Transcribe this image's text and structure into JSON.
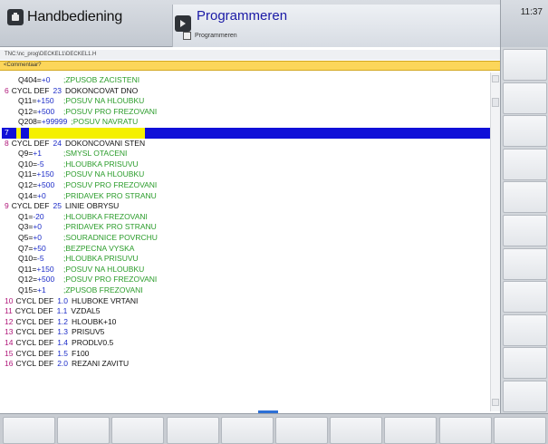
{
  "header": {
    "mode_left": "Handbediening",
    "mode_right": "Programmeren",
    "mode_right_sub": "Programmeren",
    "clock": "11:37"
  },
  "path": "TNC:\\nc_prog\\DECKEL1\\DECKEL1.H",
  "comment_bar": "<Commentaar?",
  "colors": {
    "line_number": "#b0187a",
    "value": "#1c2cc8",
    "comment": "#2a9c2a",
    "selection": "#1010d8",
    "cursor": "#f4f000",
    "comment_bar": "#fcd65a"
  },
  "program": [
    {
      "ln": "",
      "indent": true,
      "q": "Q404=+0",
      "c": ";ZPUSOB ZACISTENI"
    },
    {
      "ln": "6",
      "kw": "CYCL DEF",
      "num": "23",
      "txt": "DOKONCOVAT DNO"
    },
    {
      "ln": "",
      "indent": true,
      "q": "Q11=+150",
      "c": ";POSUV NA HLOUBKU"
    },
    {
      "ln": "",
      "indent": true,
      "q": "Q12=+500",
      "c": ";POSUV PRO FREZOVANI"
    },
    {
      "ln": "",
      "indent": true,
      "q": "Q208=+99999",
      "c": ";POSUV NAVRATU"
    },
    {
      "ln": "7",
      "selected": true
    },
    {
      "ln": "8",
      "kw": "CYCL DEF",
      "num": "24",
      "txt": "DOKONCOVANI STEN"
    },
    {
      "ln": "",
      "indent": true,
      "q": "Q9=+1",
      "c": ";SMYSL OTACENI"
    },
    {
      "ln": "",
      "indent": true,
      "q": "Q10=-5",
      "c": ";HLOUBKA PRISUVU"
    },
    {
      "ln": "",
      "indent": true,
      "q": "Q11=+150",
      "c": ";POSUV NA HLOUBKU"
    },
    {
      "ln": "",
      "indent": true,
      "q": "Q12=+500",
      "c": ";POSUV PRO FREZOVANI"
    },
    {
      "ln": "",
      "indent": true,
      "q": "Q14=+0",
      "c": ";PRIDAVEK PRO STRANU"
    },
    {
      "ln": "9",
      "kw": "CYCL DEF",
      "num": "25",
      "txt": "LINIE OBRYSU"
    },
    {
      "ln": "",
      "indent": true,
      "q": "Q1=-20",
      "c": ";HLOUBKA FREZOVANI"
    },
    {
      "ln": "",
      "indent": true,
      "q": "Q3=+0",
      "c": ";PRIDAVEK PRO STRANU"
    },
    {
      "ln": "",
      "indent": true,
      "q": "Q5=+0",
      "c": ";SOURADNICE POVRCHU"
    },
    {
      "ln": "",
      "indent": true,
      "q": "Q7=+50",
      "c": ";BEZPECNA VYSKA"
    },
    {
      "ln": "",
      "indent": true,
      "q": "Q10=-5",
      "c": ";HLOUBKA PRISUVU"
    },
    {
      "ln": "",
      "indent": true,
      "q": "Q11=+150",
      "c": ";POSUV NA HLOUBKU"
    },
    {
      "ln": "",
      "indent": true,
      "q": "Q12=+500",
      "c": ";POSUV PRO FREZOVANI"
    },
    {
      "ln": "",
      "indent": true,
      "q": "Q15=+1",
      "c": ";ZPUSOB FREZOVANI"
    },
    {
      "ln": "10",
      "kw": "CYCL DEF",
      "num": "1.0",
      "txt": "HLUBOKE VRTANI"
    },
    {
      "ln": "11",
      "kw": "CYCL DEF",
      "num": "1.1",
      "txt": "VZDAL5"
    },
    {
      "ln": "12",
      "kw": "CYCL DEF",
      "num": "1.2",
      "txt": "HLOUBK+10"
    },
    {
      "ln": "13",
      "kw": "CYCL DEF",
      "num": "1.3",
      "txt": "PRISUV5"
    },
    {
      "ln": "14",
      "kw": "CYCL DEF",
      "num": "1.4",
      "txt": "PRODLV0.5"
    },
    {
      "ln": "15",
      "kw": "CYCL DEF",
      "num": "1.5",
      "txt": "F100"
    },
    {
      "ln": "16",
      "kw": "CYCL DEF",
      "num": "2.0",
      "txt": "REZANI ZAVITU"
    }
  ],
  "softkeys_right_count": 11,
  "softkeys_bottom_count": 10
}
